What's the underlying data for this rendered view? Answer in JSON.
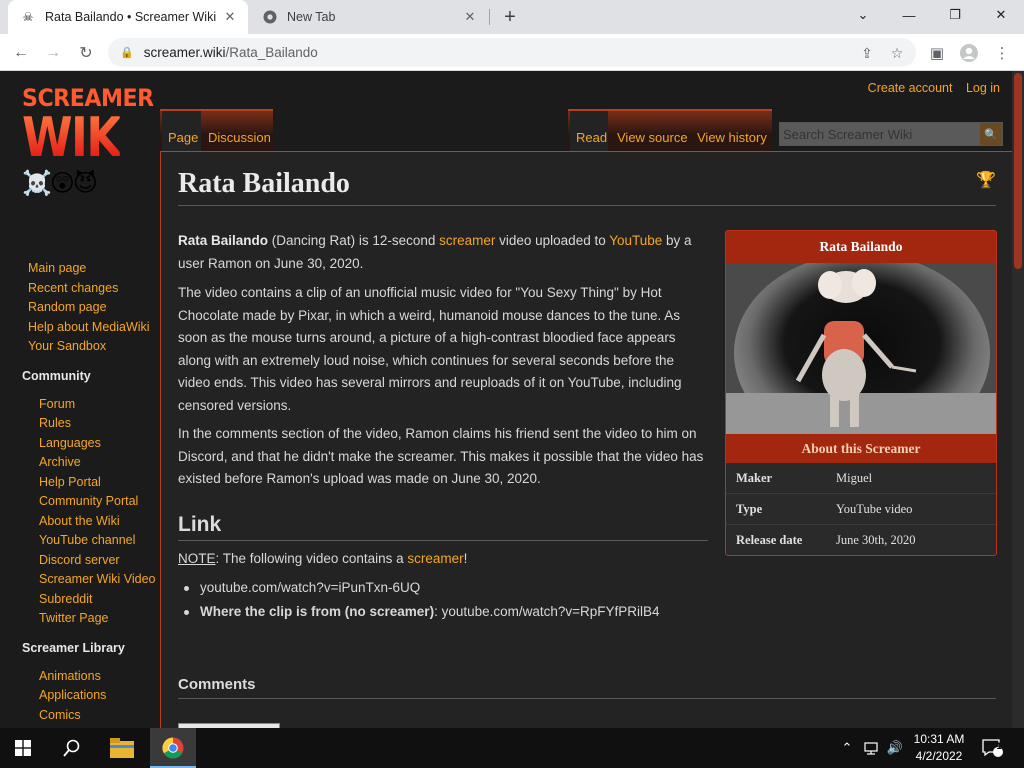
{
  "browser": {
    "tabs": [
      {
        "title": "Rata Bailando • Screamer Wiki",
        "favicon": "screamer-wiki-icon"
      },
      {
        "title": "New Tab",
        "favicon": "chrome-icon"
      }
    ],
    "url_host": "screamer.wiki",
    "url_path": "/Rata_Bailando"
  },
  "wiki": {
    "logo_line1": "SCREAMER",
    "logo_line2": "WIKI",
    "logo_emoji": "☠️😲😈",
    "top_links": [
      "Create account",
      "Log in"
    ],
    "nav_main": [
      "Main page",
      "Recent changes",
      "Random page",
      "Help about MediaWiki",
      "Your Sandbox"
    ],
    "community_heading": "Community",
    "nav_community": [
      "Forum",
      "Rules",
      "Languages",
      "Archive",
      "Help Portal",
      "Community Portal",
      "About the Wiki",
      "YouTube channel",
      "Discord server",
      "Screamer Wiki Video",
      "Subreddit",
      "Twitter Page"
    ],
    "library_heading": "Screamer Library",
    "nav_library": [
      "Animations",
      "Applications",
      "Comics"
    ],
    "page_tabs": {
      "page": "Page",
      "discussion": "Discussion",
      "read": "Read",
      "view_source": "View source",
      "view_history": "View history"
    },
    "search_placeholder": "Search Screamer Wiki"
  },
  "article": {
    "title": "Rata Bailando",
    "p1_bold": "Rata Bailando",
    "p1_a": " (Dancing Rat) is 12-second ",
    "p1_link1": "screamer",
    "p1_b": " video uploaded to ",
    "p1_link2": "YouTube",
    "p1_c": " by a user Ramon on June 30, 2020.",
    "p2": "The video contains a clip of an unofficial music video for \"You Sexy Thing\" by Hot Chocolate made by Pixar, in which a weird, humanoid mouse dances to the tune. As soon as the mouse turns around, a picture of a high-contrast bloodied face appears along with an extremely loud noise, which continues for several seconds before the video ends. This video has several mirrors and reuploads of it on YouTube, including censored versions.",
    "p3": "In the comments section of the video, Ramon claims his friend sent the video to him on Discord, and that he didn't make the screamer. This makes it possible that the video has existed before Ramon's upload was made on June 30, 2020.",
    "link_heading": "Link",
    "note_label": "NOTE",
    "note_text": ": The following video contains a ",
    "note_link": "screamer",
    "note_end": "!",
    "bullet1": "youtube.com/watch?v=iPunTxn-6UQ",
    "bullet2_bold": "Where the clip is from (no screamer)",
    "bullet2_sep": ": ",
    "bullet2_link": "youtube.com/watch?v=RpFYfPRilB4",
    "comments_heading": "Comments"
  },
  "infobox": {
    "title": "Rata Bailando",
    "subtitle": "About this Screamer",
    "rows": [
      {
        "key": "Maker",
        "value": "Miguel"
      },
      {
        "key": "Type",
        "value": "YouTube video"
      },
      {
        "key": "Release date",
        "value": "June 30th, 2020"
      }
    ]
  },
  "taskbar": {
    "time": "10:31 AM",
    "date": "4/2/2022",
    "notification_count": "1"
  }
}
